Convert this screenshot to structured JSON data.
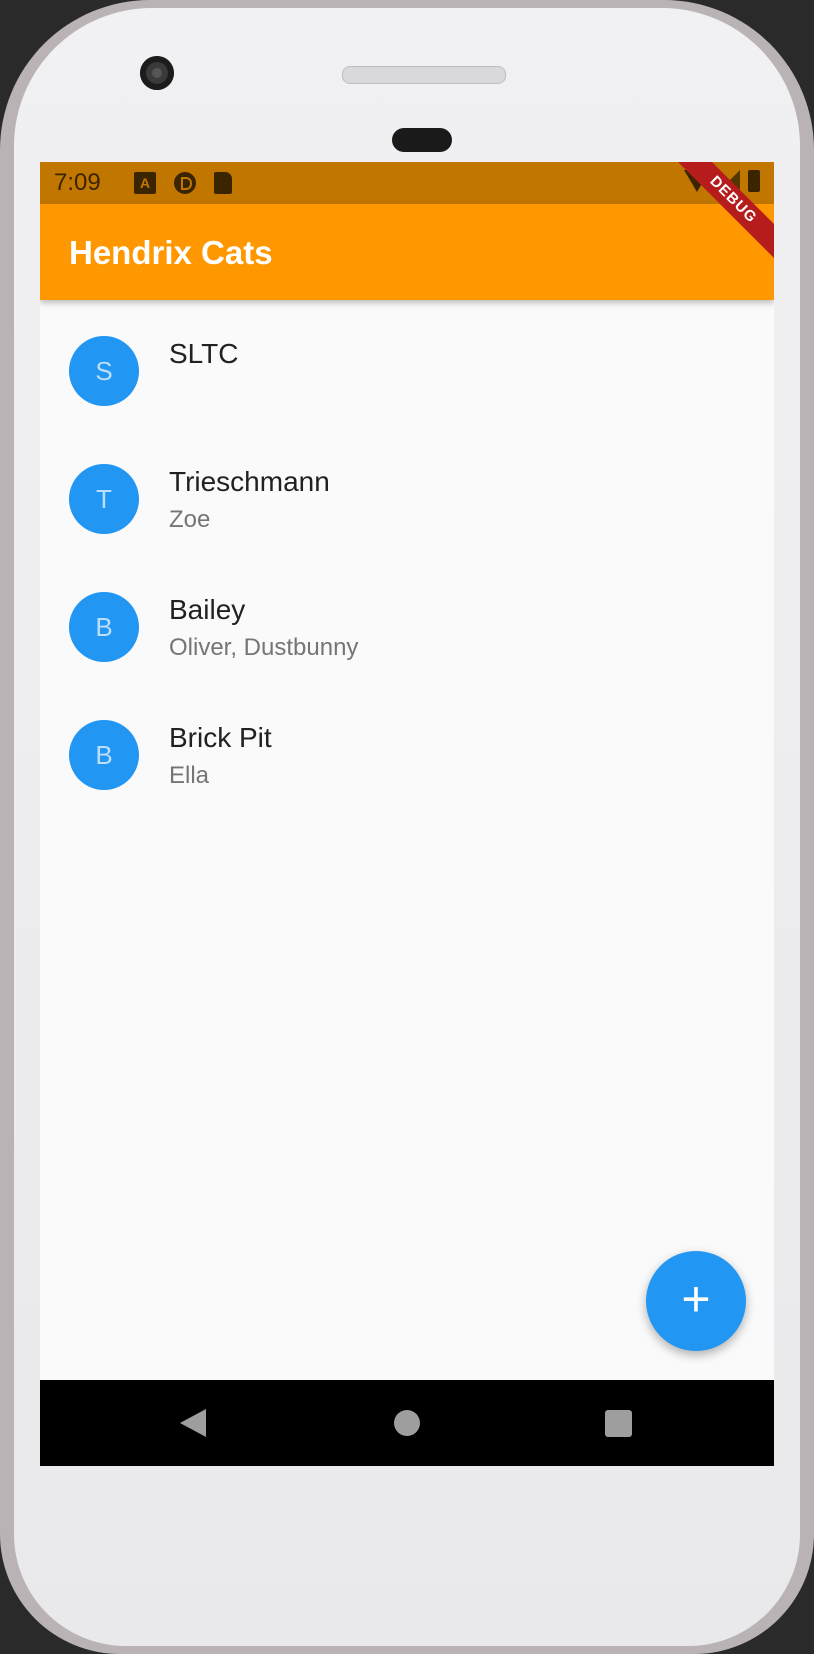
{
  "status_bar": {
    "time": "7:09",
    "icons": [
      "a-icon",
      "p-icon",
      "sd-card-icon",
      "wifi-icon",
      "cell-signal-icon",
      "battery-icon"
    ]
  },
  "debug_banner": "DEBUG",
  "app_bar": {
    "title": "Hendrix Cats",
    "color": "#ff9800",
    "status_color": "#c17600"
  },
  "list": {
    "items": [
      {
        "avatar": "S",
        "title": "SLTC",
        "subtitle": ""
      },
      {
        "avatar": "T",
        "title": "Trieschmann",
        "subtitle": "Zoe"
      },
      {
        "avatar": "B",
        "title": "Bailey",
        "subtitle": "Oliver, Dustbunny"
      },
      {
        "avatar": "B",
        "title": "Brick Pit",
        "subtitle": "Ella"
      }
    ]
  },
  "fab": {
    "label": "+",
    "icon": "add-icon",
    "color": "#2196f3"
  },
  "nav_bar": {
    "icons": [
      "back-icon",
      "home-icon",
      "recents-icon"
    ]
  }
}
